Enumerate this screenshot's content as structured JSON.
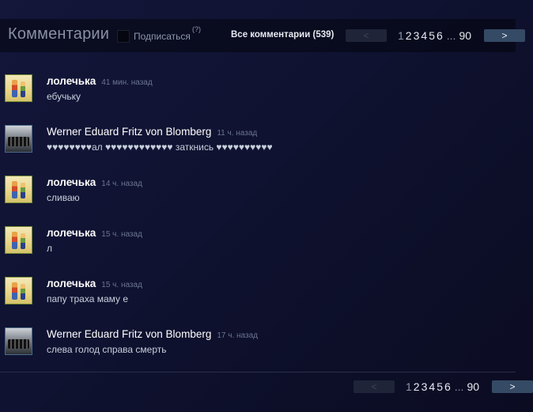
{
  "header": {
    "title": "Комментарии",
    "subscribe_label": "Подписаться",
    "help_label": "(?)",
    "all_comments": "Все комментарии (539)"
  },
  "pager": {
    "prev_label": "<",
    "next_label": ">",
    "current": "1",
    "pages": [
      "2",
      "3",
      "4",
      "5",
      "6"
    ],
    "ellipsis": "...",
    "last": "90"
  },
  "comments": [
    {
      "author": "лолечька",
      "time": "41 мин. назад",
      "text": "ебучьку",
      "avatar": "girl-avatar"
    },
    {
      "author": "Werner Eduard Fritz von Blomberg",
      "time": "11 ч. назад",
      "text": "♥♥♥♥♥♥♥♥ал ♥♥♥♥♥♥♥♥♥♥♥♥ заткнись ♥♥♥♥♥♥♥♥♥♥",
      "avatar": "train-avatar"
    },
    {
      "author": "лолечька",
      "time": "14 ч. назад",
      "text": "сливаю",
      "avatar": "girl-avatar"
    },
    {
      "author": "лолечька",
      "time": "15 ч. назад",
      "text": "л",
      "avatar": "girl-avatar"
    },
    {
      "author": "лолечька",
      "time": "15 ч. назад",
      "text": "папу траха маму е",
      "avatar": "girl-avatar"
    },
    {
      "author": "Werner Eduard Fritz von Blomberg",
      "time": "17 ч. назад",
      "text": "слева голод справа смерть",
      "avatar": "train-avatar"
    }
  ],
  "colors": {
    "background": "#10122e",
    "next_button": "#354a64",
    "prev_button": "#1f2438",
    "author": "#ffffff",
    "timestamp": "#6a7590"
  }
}
